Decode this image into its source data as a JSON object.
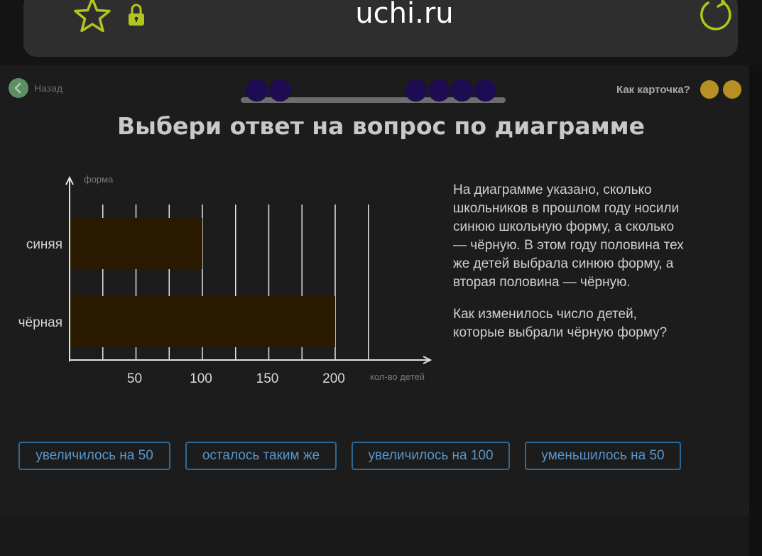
{
  "browser": {
    "domain": "uchi.ru",
    "icons": {
      "favorite": "star-icon",
      "secure": "lock-icon",
      "reload": "reload-icon"
    },
    "colors": {
      "icon": "#b2c51f",
      "domain_text": "#ffffff"
    }
  },
  "nav": {
    "back_label": "Назад",
    "back_icon": "chevron-left-icon",
    "how_card_label": "Как карточка?",
    "rating_buttons": [
      "rating-button-1",
      "rating-button-2"
    ]
  },
  "progress": {
    "total_steps": 8,
    "filled_steps": [
      0,
      1,
      4,
      5,
      6,
      7
    ],
    "colors": {
      "dot": "#1e0c52",
      "track": "#6d6d6d"
    }
  },
  "task": {
    "title": "Выбери ответ на вопрос по диаграмме",
    "description": "На диаграмме указано, сколько школьников в прошлом году носили синюю школьную форму, а сколько — чёрную. В этом году половина тех же детей выбрала синюю форму, а вторая половина — чёрную.",
    "question": "Как изменилось число детей, которые выбрали чёрную форму?"
  },
  "chart_data": {
    "type": "bar",
    "orientation": "horizontal",
    "categories": [
      "синяя",
      "чёрная"
    ],
    "values": [
      100,
      200
    ],
    "xlabel": "кол-во детей",
    "ylabel": "форма",
    "xticks": [
      "50",
      "100",
      "150",
      "200"
    ],
    "xlim": [
      0,
      225
    ],
    "grid": true,
    "colors": {
      "bar": "#2a1b00"
    }
  },
  "answers": [
    "увеличилось на 50",
    "осталось таким же",
    "увеличилось на 100",
    "уменьшилось на 50"
  ]
}
